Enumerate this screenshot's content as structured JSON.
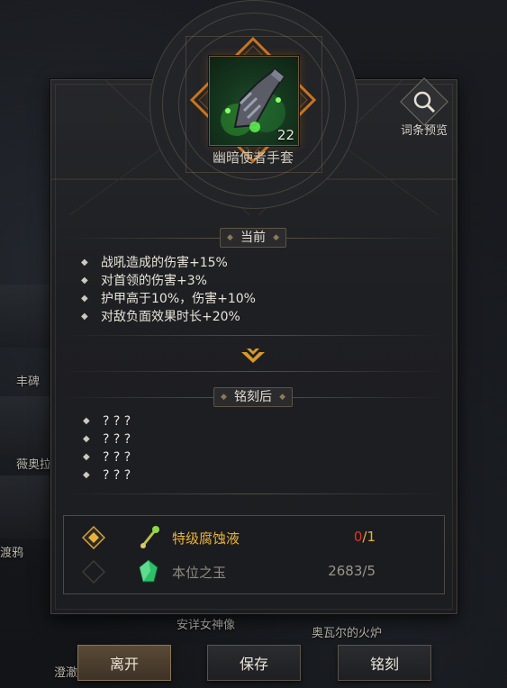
{
  "background": {
    "labels": [
      "丰碑",
      "薇奥拉",
      "渡鸦",
      "安详女神像",
      "奥瓦尔的火炉",
      "澄澈"
    ]
  },
  "item": {
    "name": "幽暗使者手套",
    "count": "22",
    "icon": "gauntlet-icon"
  },
  "preview": {
    "label": "词条预览",
    "icon": "magnifier-icon"
  },
  "current": {
    "header": "当前",
    "attributes": [
      "战吼造成的伤害+15%",
      "对首领的伤害+3%",
      "护甲高于10%，伤害+10%",
      "对敌负面效果时长+20%"
    ]
  },
  "after": {
    "header": "铭刻后",
    "attributes": [
      "? ? ?",
      "? ? ?",
      "? ? ?",
      "? ? ?"
    ]
  },
  "materials": [
    {
      "name": "特级腐蚀液",
      "have": "0",
      "need": "/1",
      "icon": "corrosion-vial-icon",
      "checked": true,
      "name_color": "#e8b23a",
      "have_color": "#e0332b",
      "need_color": "#e8b23a"
    },
    {
      "name": "本位之玉",
      "qty": "2683/5",
      "icon": "green-crystal-icon",
      "checked": false,
      "name_color": "#8f8a80",
      "qty_color": "#9a958b"
    }
  ],
  "buttons": {
    "leave": "离开",
    "save": "保存",
    "engrave": "铭刻"
  },
  "colors": {
    "accent_gold": "#e8b23a",
    "deficit_red": "#e0332b",
    "frame_brown": "#5b554a"
  }
}
